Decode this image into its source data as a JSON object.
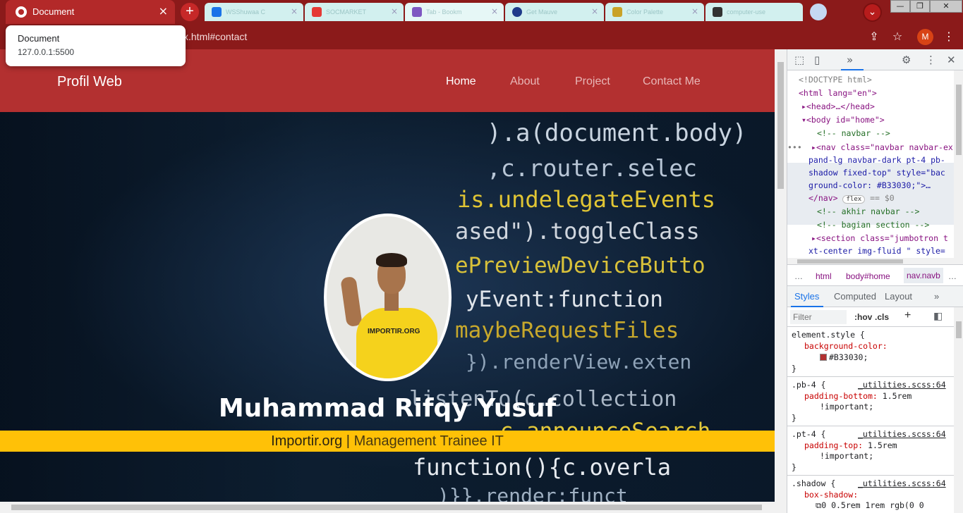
{
  "browser": {
    "active_tab_title": "Document",
    "background_tabs": [
      {
        "label": "WSShuwaa C",
        "color": "#1a73e8"
      },
      {
        "label": "SOCMARKET",
        "color": "#e53935"
      },
      {
        "label": "Tab - Bookm",
        "color": "#7e57c2"
      },
      {
        "label": "Get Mauve",
        "color": "#1e3a8a"
      },
      {
        "label": "Color Palette",
        "color": "#c9a227"
      },
      {
        "label": "computer-use",
        "color": "#333333"
      }
    ],
    "url_suffix": "x.html#contact",
    "profile_initial": "M",
    "new_tab_glyph": "+",
    "close_glyph": "×"
  },
  "tooltip": {
    "title": "Document",
    "address": "127.0.0.1:5500"
  },
  "page": {
    "brand": "Profil Web",
    "nav": [
      {
        "label": "Home",
        "active": true
      },
      {
        "label": "About",
        "active": false
      },
      {
        "label": "Project",
        "active": false
      },
      {
        "label": "Contact Me",
        "active": false
      }
    ],
    "name": "Muhammad Rifqy Yusuf",
    "company": "Importir.org",
    "separator": "|",
    "role": "Management Trainee IT",
    "shirt_logo": "IMPORTIR.ORG",
    "background_code": [
      ").a(document.body)",
      ",c.router.selec",
      "is.undelegateEvents",
      "ased\").toggleClass",
      "ePreviewDeviceButto",
      "yEvent:function",
      "maybeRequestFiles",
      "}).renderView.exten",
      "listenTo(c.collection",
      ",c.announceSearch",
      "function(){c.overla",
      ")}}.render:funct"
    ],
    "colors": {
      "navbar": "#B33030",
      "band": "#FFC107"
    }
  },
  "devtools": {
    "dom_lines": [
      "<!DOCTYPE html>",
      "<html lang=\"en\">",
      "<head>…</head>",
      "<body id=\"home\">",
      "<!-- navbar -->",
      "<nav class=\"navbar navbar-ex",
      "pand-lg navbar-dark pt-4 pb-",
      "shadow fixed-top\" style=\"bac",
      "ground-color: #B33030;\">…",
      "</nav>",
      "flex",
      "== $0",
      "<!-- akhir navbar -->",
      "<!-- bagian section -->",
      "<section class=\"jumbotron t",
      "xt-center img-fluid \" style="
    ],
    "breadcrumbs": [
      "…",
      "html",
      "body#home",
      "nav.navb",
      "…"
    ],
    "subtabs": [
      "Styles",
      "Computed",
      "Layout",
      "»"
    ],
    "filter_placeholder": "Filter",
    "hov": ":hov",
    "cls": ".cls",
    "styles": [
      {
        "selector": "element.style {",
        "source": "",
        "props": [
          [
            "background-color:",
            "#B33030;"
          ]
        ]
      },
      {
        "selector": ".pb-4 {",
        "source": "_utilities.scss:64",
        "props": [
          [
            "padding-bottom:",
            "1.5rem"
          ],
          [
            "",
            "!important;"
          ]
        ]
      },
      {
        "selector": ".pt-4 {",
        "source": "_utilities.scss:64",
        "props": [
          [
            "padding-top:",
            "1.5rem"
          ],
          [
            "",
            "!important;"
          ]
        ]
      },
      {
        "selector": ".shadow {",
        "source": "_utilities.scss:64",
        "props": [
          [
            "box-shadow:",
            ""
          ],
          [
            "",
            "0 0.5rem 1rem rgb(0 0"
          ]
        ]
      }
    ]
  }
}
